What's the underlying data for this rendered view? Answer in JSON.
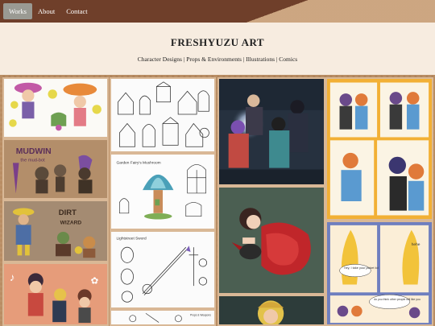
{
  "nav": {
    "items": [
      {
        "label": "Works",
        "active": true
      },
      {
        "label": "About",
        "active": false
      },
      {
        "label": "Contact",
        "active": false
      }
    ]
  },
  "header": {
    "title": "FRESHYUZU ART",
    "subtitle": "Character Designs | Props & Environments | Illustrations | Comics"
  },
  "gallery": {
    "sketch_captions": {
      "garden_fairy": "Garden Fairy's Mushroom",
      "lightstreet_sword": "Lightstreet Sword",
      "props": "Props & Weapons"
    },
    "art_text": {
      "mudwin": "MUDWIN",
      "mudwin_sub": "the mud-bot",
      "dirt": "DIRT",
      "wizard": "WIZARD",
      "speech_1": "hey, I take your jacket lol",
      "speech_2": "do you think other people will like you",
      "speech_3": "hehe"
    }
  },
  "colors": {
    "nav_bg": "#6f3f2a",
    "header_bg": "#f7ece0",
    "page_bg": "#b98d63",
    "active_tab": "#9a9a93"
  }
}
